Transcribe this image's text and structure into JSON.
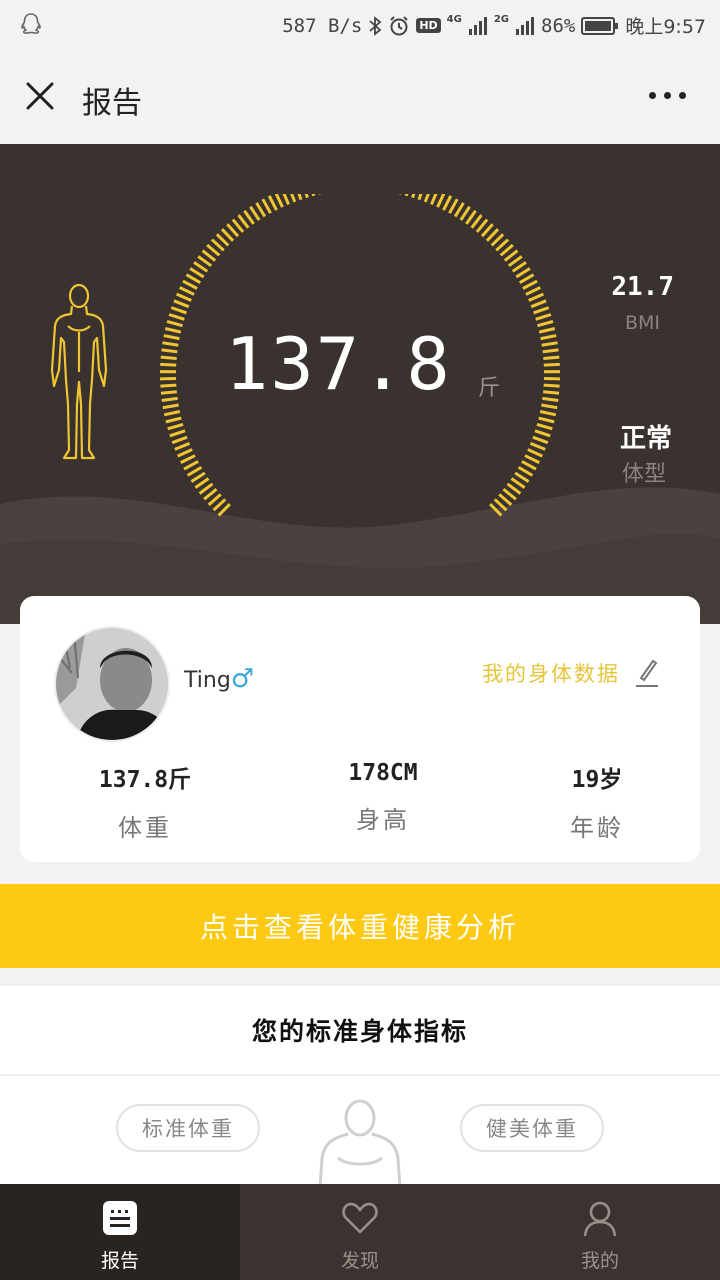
{
  "status_bar": {
    "speed": "587 B/s",
    "hd": "HD",
    "net1": "4G",
    "net2": "2G",
    "battery": "86%",
    "time": "晚上9:57"
  },
  "header": {
    "title": "报告"
  },
  "hero": {
    "weight": "137.8",
    "weight_unit": "斤",
    "bmi_value": "21.7",
    "bmi_label": "BMI",
    "body_type_value": "正常",
    "body_type_label": "体型"
  },
  "profile": {
    "name": "Ting",
    "gender_symbol": "♂",
    "my_data_link": "我的身体数据",
    "stats": [
      {
        "value": "137.8斤",
        "label": "体重"
      },
      {
        "value": "178CM",
        "label": "身高"
      },
      {
        "value": "19岁",
        "label": "年龄"
      }
    ]
  },
  "analysis_button": "点击查看体重健康分析",
  "indicators": {
    "title": "您的标准身体指标",
    "standard_weight_label": "标准体重",
    "fit_weight_label": "健美体重"
  },
  "tabs": [
    {
      "label": "报告",
      "icon": "report-icon",
      "active": true
    },
    {
      "label": "发现",
      "icon": "heart-icon",
      "active": false
    },
    {
      "label": "我的",
      "icon": "person-icon",
      "active": false
    }
  ],
  "colors": {
    "accent_yellow": "#fdc913",
    "gauge_yellow": "#f0c531",
    "hero_bg": "#39322f",
    "male_blue": "#3aa6d8"
  }
}
